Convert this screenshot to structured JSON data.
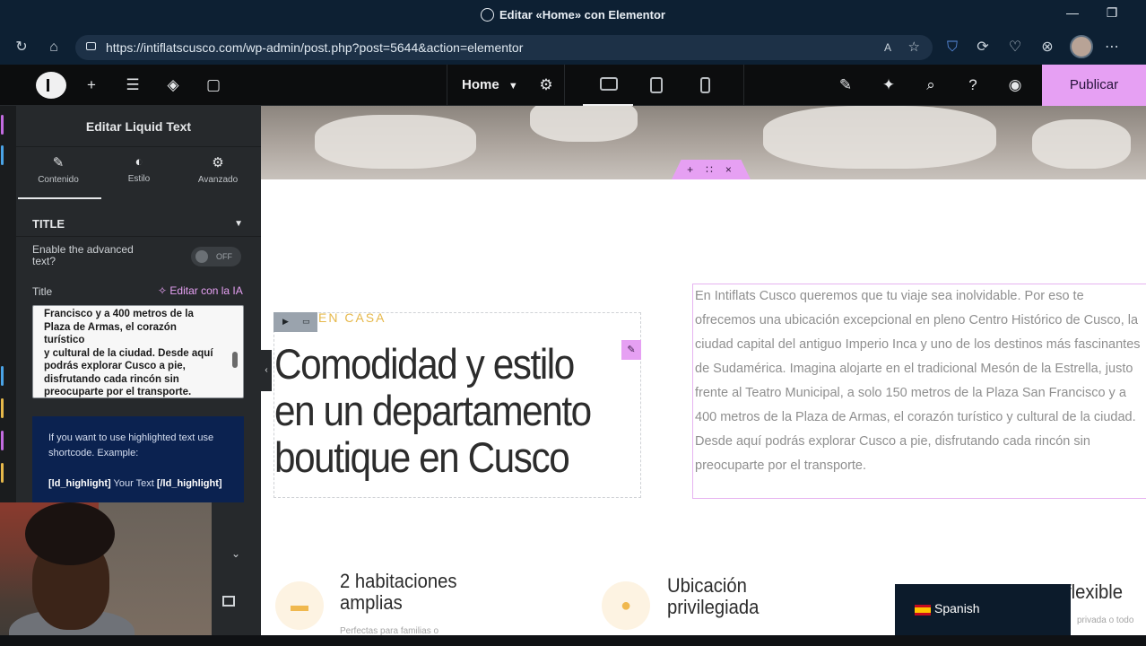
{
  "browser": {
    "window_title": "Editar «Home» con Elementor",
    "url": "https://intiflatscusco.com/wp-admin/post.php?post=5644&action=elementor"
  },
  "topbar": {
    "page_name": "Home",
    "publish_label": "Publicar"
  },
  "sidebar": {
    "header": "Editar Liquid Text",
    "tabs": [
      {
        "label": "Contenido"
      },
      {
        "label": "Estilo"
      },
      {
        "label": "Avanzado"
      }
    ],
    "section_title": "TITLE",
    "advanced_label": "Enable the advanced text?",
    "toggle_state": "OFF",
    "title_label": "Title",
    "ai_button": "Editar con la IA",
    "title_text": "Francisco y a 400 metros de la\nPlaza de Armas, el corazón\nturístico\ny cultural de la ciudad. Desde aquí\npodrás explorar Cusco a pie,\ndisfrutando cada rincón sin\npreocuparte por el transporte.",
    "notice_text": "If you want to use highlighted text use shortcode. Example:",
    "notice_code_open": "[ld_highlight]",
    "notice_code_mid": " Your Text ",
    "notice_code_close": "[/ld_highlight]"
  },
  "canvas": {
    "kicker": "EN CASA",
    "heading": "Comodidad y estilo en un departamento boutique en Cusco",
    "paragraph": "En Intiflats Cusco queremos que tu viaje sea inolvidable. Por eso te ofrecemos una ubicación excepcional en pleno Centro Histórico de Cusco, la ciudad capital del antiguo Imperio Inca y uno de los destinos más fascinantes de Sudamérica. Imagina alojarte en el tradicional Mesón de la Estrella, justo frente al Teatro Municipal, a solo 150 metros de la Plaza San Francisco y a 400 metros de la Plaza de Armas, el corazón turístico y cultural de la ciudad. Desde aquí podrás explorar Cusco a pie, disfrutando cada rincón sin preocuparte por el transporte.",
    "features": [
      {
        "title": "2 habitaciones amplias",
        "subtitle": "Perfectas para familias o"
      },
      {
        "title": "Ubicación privilegiada",
        "subtitle": ""
      },
      {
        "title": "flexible",
        "subtitle": "privada o todo"
      }
    ],
    "language": "Spanish"
  },
  "colors": {
    "accent": "#e6a0f3",
    "kicker": "#e6b84a",
    "panel": "#26292c"
  }
}
